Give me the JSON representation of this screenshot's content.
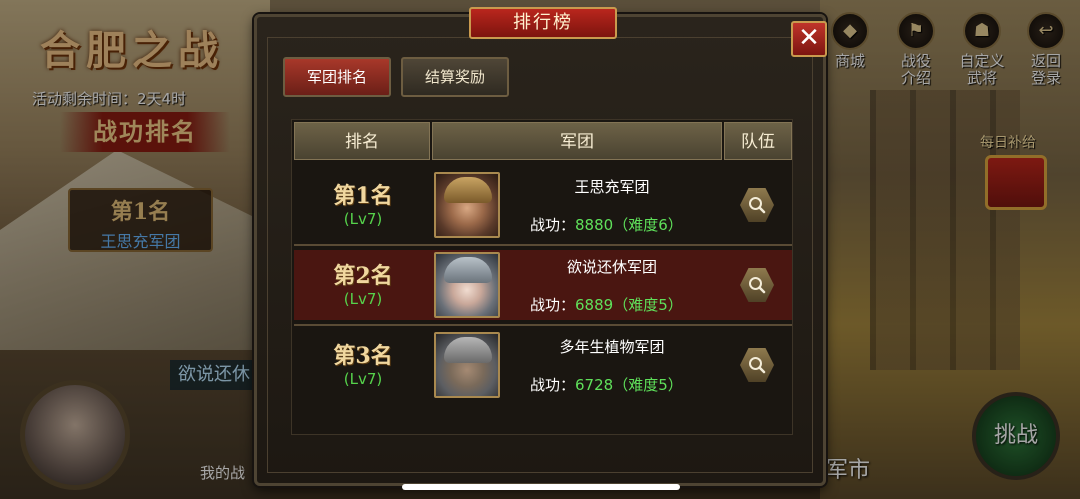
{
  "background": {
    "event_title": "合肥之战",
    "remaining_time": "活动剩余时间：2天4时",
    "merit_ranking": "战功排名",
    "first_place": {
      "rank": "第1名",
      "name": "王思充军团"
    },
    "bottom_banner": "欲说还休",
    "my_battle": "我的战"
  },
  "right_menu": [
    {
      "label": "商城",
      "icon": "shop-icon"
    },
    {
      "label": "战役\n介绍",
      "icon": "campaign-icon"
    },
    {
      "label": "自定义\n武将",
      "icon": "custom-general-icon"
    },
    {
      "label": "返回\n登录",
      "icon": "return-icon"
    }
  ],
  "daily_supply": "每日补给",
  "challenge_label": "挑战",
  "market_label": "军市",
  "modal": {
    "title": "排行榜",
    "close_icon": "close-icon",
    "tabs": [
      {
        "label": "军团排名",
        "active": true
      },
      {
        "label": "结算奖励",
        "active": false
      }
    ],
    "headers": [
      "排名",
      "军团",
      "队伍"
    ],
    "rows": [
      {
        "rank": "第1名",
        "level": "(Lv7)",
        "legion": "王思充军团",
        "merit_label": "战功：",
        "merit": "8880（难度6）"
      },
      {
        "rank": "第2名",
        "level": "(Lv7)",
        "legion": "欲说还休军团",
        "merit_label": "战功：",
        "merit": "6889（难度5）"
      },
      {
        "rank": "第3名",
        "level": "(Lv7)",
        "legion": "多年生植物军团",
        "merit_label": "战功：",
        "merit": "6728（难度5）"
      }
    ]
  }
}
